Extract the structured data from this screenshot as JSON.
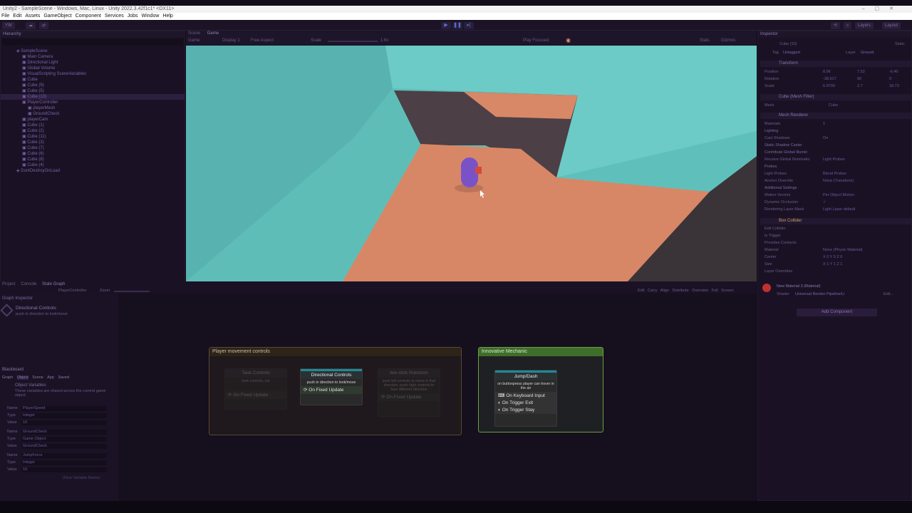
{
  "window": {
    "title": "Unity2 - SampleScene - Windows, Mac, Linux - Unity 2022.3.42f1c1* <DX11>"
  },
  "menu": [
    "File",
    "Edit",
    "Assets",
    "GameObject",
    "Component",
    "Services",
    "Jobs",
    "Window",
    "Help"
  ],
  "toolbar": {
    "account": "YW",
    "layers": "Layers",
    "layout": "Layout"
  },
  "hierarchy": {
    "tab": "Hierarchy",
    "items": [
      {
        "label": "SampleScene",
        "indent": 0
      },
      {
        "label": "Main Camera",
        "indent": 1
      },
      {
        "label": "Directional Light",
        "indent": 1
      },
      {
        "label": "Global Volume",
        "indent": 1
      },
      {
        "label": "VisualScripting SceneVariables",
        "indent": 1
      },
      {
        "label": "Cube",
        "indent": 1
      },
      {
        "label": "Cube (9)",
        "indent": 1
      },
      {
        "label": "Cube (5)",
        "indent": 1
      },
      {
        "label": "Cube (10)",
        "indent": 1,
        "selected": true
      },
      {
        "label": "PlayerController",
        "indent": 1
      },
      {
        "label": "playerMesh",
        "indent": 2
      },
      {
        "label": "GroundCheck",
        "indent": 2
      },
      {
        "label": "playerCam",
        "indent": 1
      },
      {
        "label": "Cube (1)",
        "indent": 1
      },
      {
        "label": "Cube (2)",
        "indent": 1
      },
      {
        "label": "Cube (11)",
        "indent": 1
      },
      {
        "label": "Cube (3)",
        "indent": 1
      },
      {
        "label": "Cube (7)",
        "indent": 1
      },
      {
        "label": "Cube (6)",
        "indent": 1
      },
      {
        "label": "Cube (8)",
        "indent": 1
      },
      {
        "label": "Cube (4)",
        "indent": 1
      },
      {
        "label": "DontDestroyOnLoad",
        "indent": 0
      }
    ]
  },
  "gameview": {
    "tabs": [
      "Scene",
      "Game"
    ],
    "display_mode": "Game",
    "display": "Display 1",
    "aspect": "Free Aspect",
    "scale_label": "Scale",
    "scale_value": "1.6x",
    "play_focused": "Play Focused",
    "stats": "Stats",
    "gizmos": "Gizmos"
  },
  "inspector": {
    "tab": "Inspector",
    "object_name": "Cube (10)",
    "static_label": "Static",
    "tag_label": "Tag",
    "tag": "Untagged",
    "layer_label": "Layer",
    "layer": "Ground",
    "transform": {
      "header": "Transform",
      "position": {
        "label": "Position",
        "x": "8.96",
        "y": "7.53",
        "z": "-6.40"
      },
      "rotation": {
        "label": "Rotation",
        "x": "-38.917",
        "y": "90",
        "z": "0"
      },
      "scale": {
        "label": "Scale",
        "x": "6.9709",
        "y": "2.7",
        "z": "18.73"
      }
    },
    "mesh_filter": {
      "header": "Cube (Mesh Filter)",
      "mesh_label": "Mesh",
      "mesh": "Cube"
    },
    "mesh_renderer": {
      "header": "Mesh Renderer",
      "rows": [
        {
          "label": "Materials",
          "value": "1"
        },
        {
          "label": "Lighting",
          "value": ""
        },
        {
          "label": "Cast Shadows",
          "value": "On"
        },
        {
          "label": "Static Shadow Caster",
          "value": ""
        },
        {
          "label": "Contribute Global Illumin",
          "value": ""
        },
        {
          "label": "Receive Global Illuminatio",
          "value": "Light Probes"
        },
        {
          "label": "Probes",
          "value": ""
        },
        {
          "label": "Light Probes",
          "value": "Blend Probes"
        },
        {
          "label": "Anchor Override",
          "value": "None (Transform)"
        },
        {
          "label": "Additional Settings",
          "value": ""
        },
        {
          "label": "Motion Vectors",
          "value": "Per Object Motion"
        },
        {
          "label": "Dynamic Occlusion",
          "value": "✓"
        },
        {
          "label": "Rendering Layer Mask",
          "value": "Light Layer default"
        }
      ]
    },
    "box_collider": {
      "header": "Box Collider",
      "rows": [
        {
          "label": "Edit Collider",
          "value": ""
        },
        {
          "label": "Is Trigger",
          "value": ""
        },
        {
          "label": "Provides Contacts",
          "value": ""
        },
        {
          "label": "Material",
          "value": "None (Physic Material)"
        },
        {
          "label": "Center",
          "value": "X 0    Y 0    Z 0"
        },
        {
          "label": "Size",
          "value": "X 1    Y 1    Z 1"
        },
        {
          "label": "Layer Overrides",
          "value": ""
        }
      ]
    },
    "material": {
      "name": "New Material 3 (Material)",
      "shader_label": "Shader",
      "shader": "Universal Render Pipeline/Li",
      "edit": "Edit..."
    },
    "add_component": "Add Component"
  },
  "state_graph": {
    "tabs": [
      "Project",
      "Console",
      "State Graph"
    ],
    "breadcrumb": "PlayerController",
    "zoom_label": "Zoom",
    "toolbar": [
      "Edit",
      "Carry",
      "Align",
      "Distribute",
      "Overview",
      "Full Screen"
    ]
  },
  "graph_inspector": {
    "title": "Graph Inspector",
    "node_title": "Directional Controls",
    "node_desc": "push in direction to look/move"
  },
  "blackboard": {
    "title": "Blackboard",
    "tabs": [
      "Graph",
      "Object",
      "Scene",
      "App",
      "Saved"
    ],
    "header": "Object Variables",
    "desc": "These variables are shared across the current game object.",
    "variables": [
      {
        "name": "PlayerSpeed",
        "type": "Integer",
        "value": "10"
      },
      {
        "name": "GroundCheck",
        "type": "Game Object",
        "value": "GroundCheck"
      },
      {
        "name": "JumpForce",
        "type": "Integer",
        "value": "10"
      }
    ],
    "labels": {
      "name": "Name",
      "type": "Type",
      "value": "Value"
    },
    "new_var_placeholder": "(New Variable Name)"
  },
  "canvas": {
    "groups": [
      {
        "title": "Player movement controls",
        "color": "#5a4a30"
      },
      {
        "title": "Innovative Mechanic",
        "color": "#6aa040"
      }
    ],
    "nodes": [
      {
        "title": "Tank Controls",
        "desc": "tank controls, yet",
        "footer": "On Fixed Update"
      },
      {
        "title": "Directional Controls",
        "desc": "push in direction to look/move",
        "footer": "On Fixed Update"
      },
      {
        "title": "two stick Robotron",
        "desc": "push left controls to move in that direction, push right controls to face different direction",
        "footer": "On Fixed Update"
      },
      {
        "title": "Jump/Dash",
        "desc": "on buttonpress player can hover in the air",
        "events": [
          "On Keyboard Input",
          "On Trigger Exit",
          "On Trigger Stay"
        ]
      }
    ]
  },
  "colors": {
    "accent": "#6a3fb8",
    "sky": "#6cc8c4",
    "floor": "#d88866",
    "player": "#7a52c8",
    "green_group": "#6aa040"
  }
}
